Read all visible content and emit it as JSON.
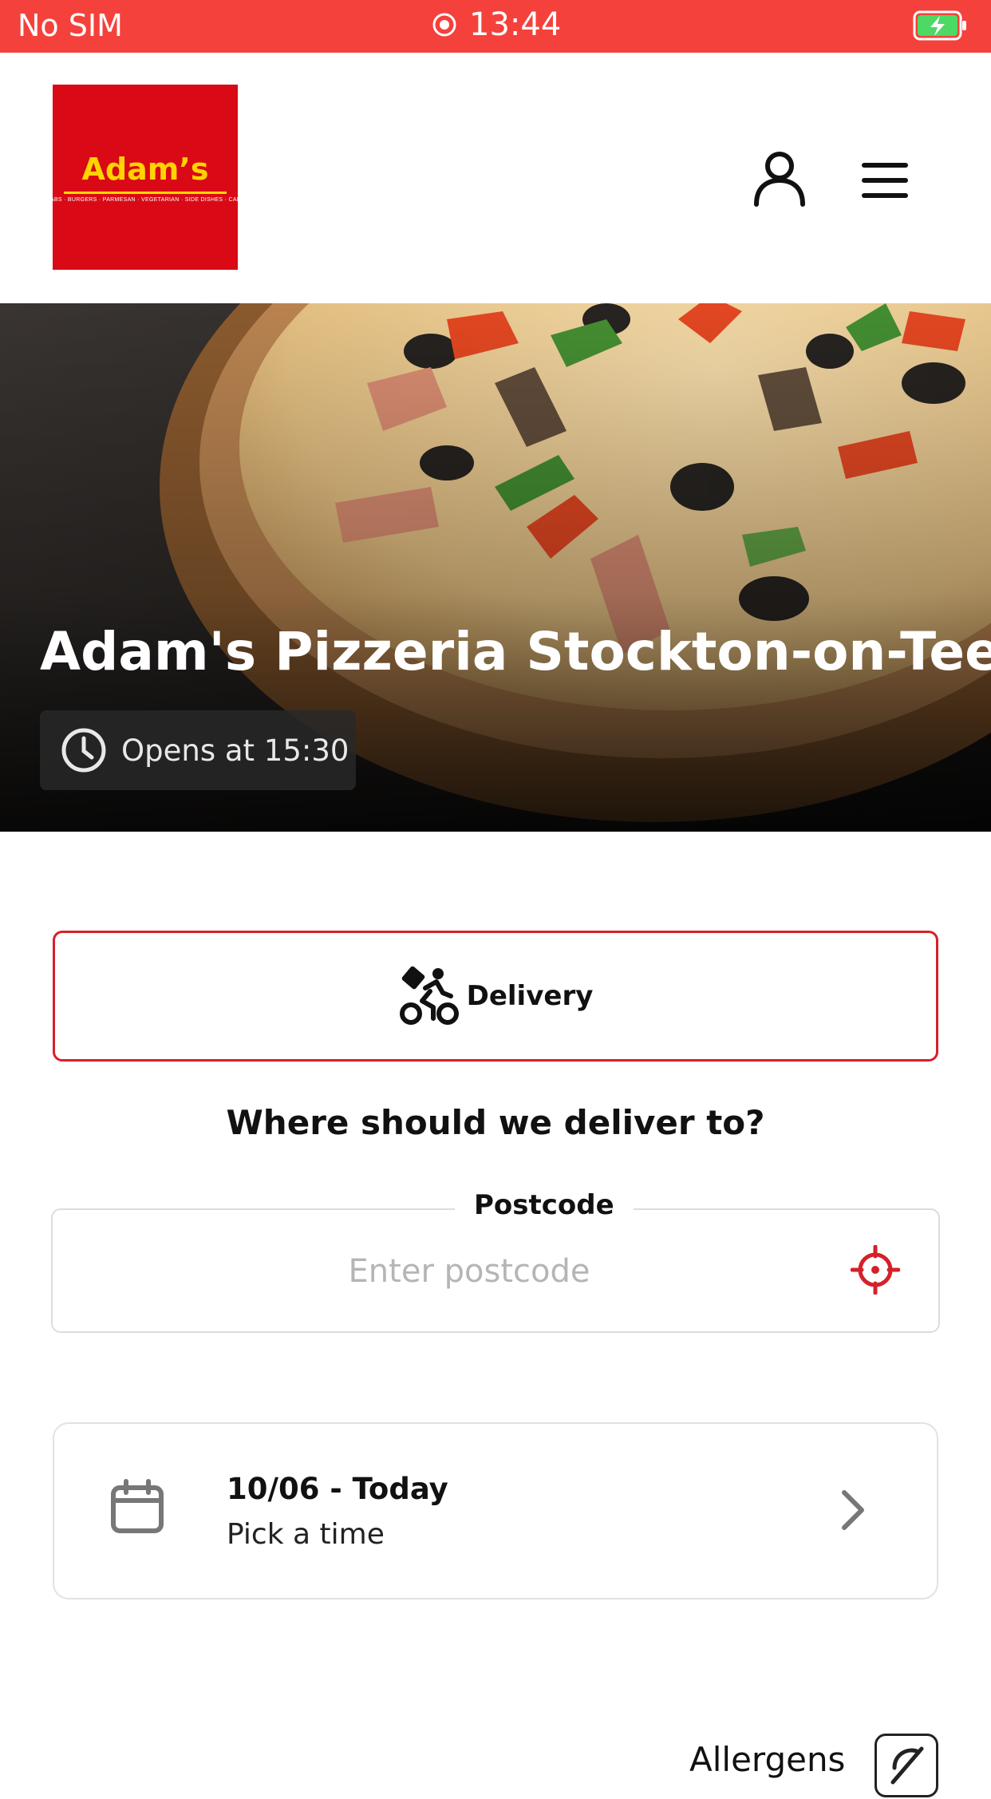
{
  "status_bar": {
    "carrier": "No SIM",
    "time": "13:44",
    "bar_color": "#f5413b"
  },
  "header": {
    "logo": {
      "name": "Adam’s",
      "tagline": "PIZZAS · KEBABS · BURGERS · PARMESAN · VEGETARIAN · SIDE DISHES · CAKES & DRINKS",
      "bg_color": "#d90a16",
      "text_color": "#ffd400"
    },
    "account_icon": "person-icon",
    "menu_icon": "hamburger-menu-icon"
  },
  "hero": {
    "title": "Adam's Pizzeria Stockton-on-Tees",
    "hours_icon": "clock-icon",
    "hours_text": "Opens at 15:30"
  },
  "order": {
    "mode_label": "Delivery",
    "mode_icon": "delivery-bike-icon",
    "accent_color": "#d6202a",
    "heading": "Where should we deliver to?",
    "postcode": {
      "label": "Postcode",
      "placeholder": "Enter postcode",
      "value": "",
      "locate_icon": "crosshair-icon"
    },
    "date": {
      "icon": "calendar-icon",
      "title": "10/06 - Today",
      "subtitle": "Pick a time",
      "chevron_icon": "chevron-right-icon"
    }
  },
  "footer": {
    "allergens_label": "Allergens",
    "allergens_icon": "allergen-icon"
  }
}
